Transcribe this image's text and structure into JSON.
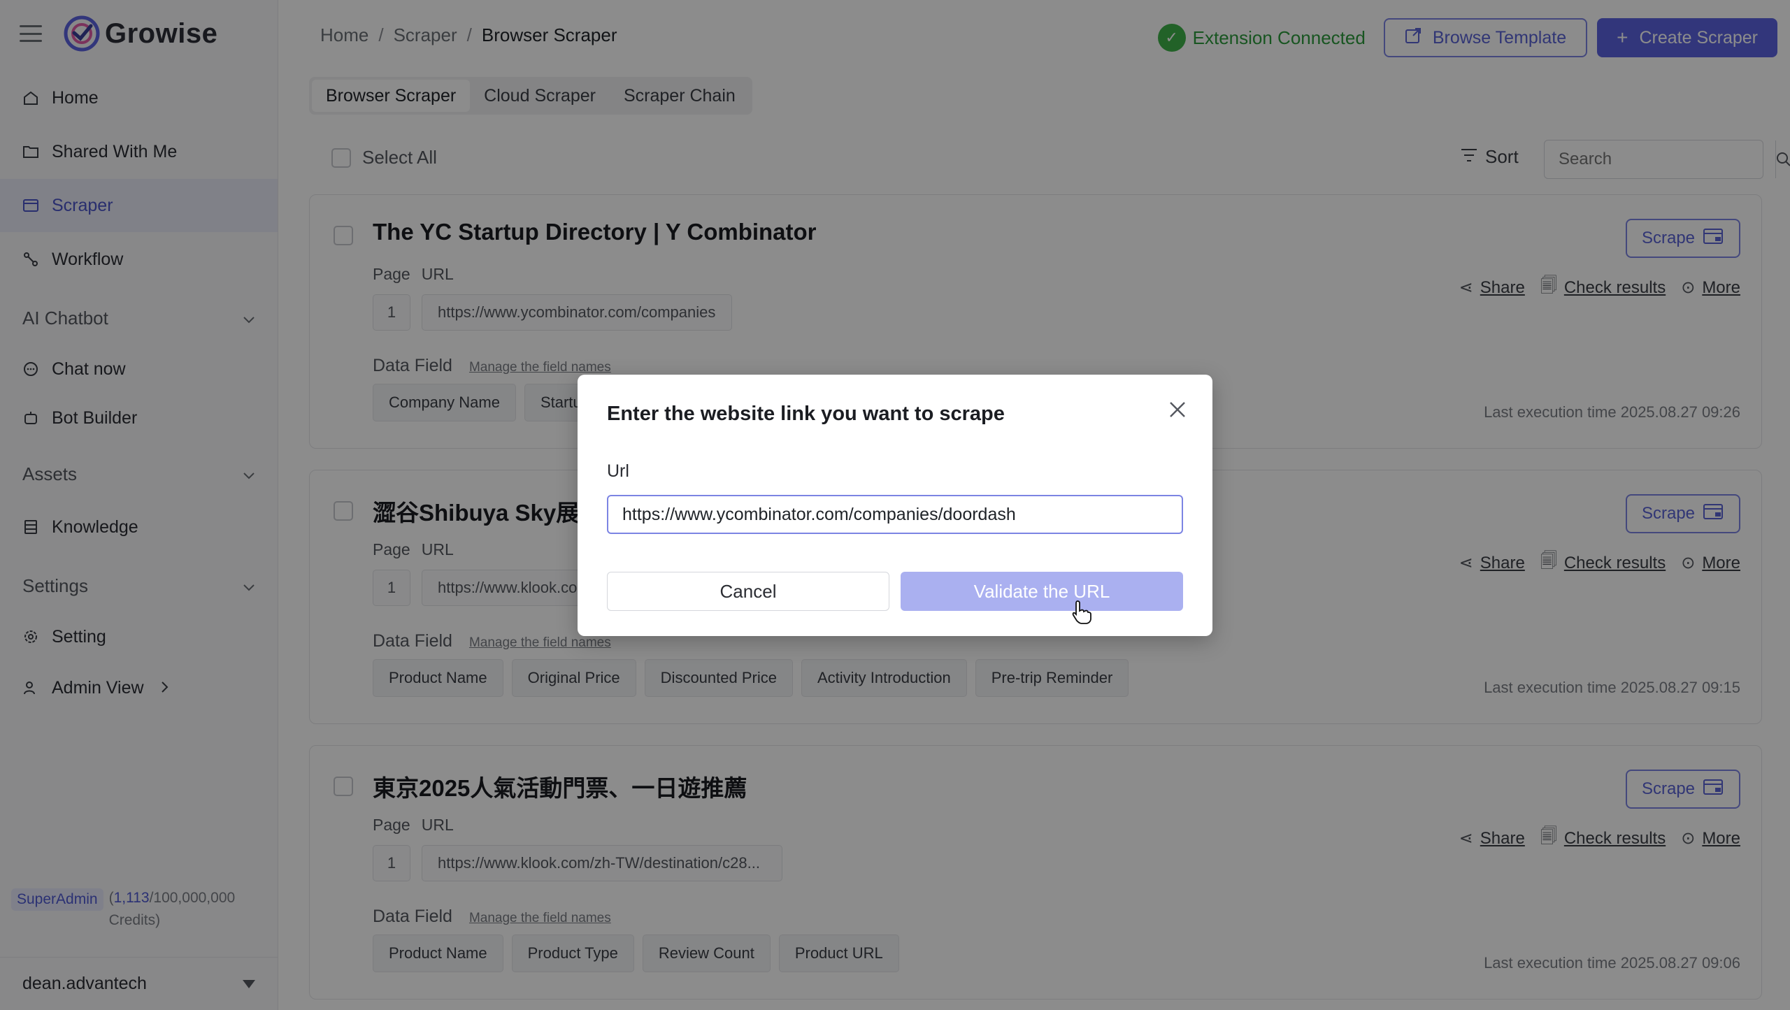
{
  "app": {
    "name": "Growise"
  },
  "sidebar": {
    "items": [
      {
        "label": "Home",
        "icon": "home-icon"
      },
      {
        "label": "Shared With Me",
        "icon": "folder-shared-icon"
      },
      {
        "label": "Scraper",
        "icon": "scraper-icon",
        "active": true
      },
      {
        "label": "Workflow",
        "icon": "workflow-icon"
      }
    ],
    "groups": {
      "ai_chatbot": "AI Chatbot",
      "chat_now": "Chat now",
      "bot_builder": "Bot Builder",
      "assets": "Assets",
      "knowledge": "Knowledge",
      "settings": "Settings",
      "setting": "Setting",
      "admin_view": "Admin View"
    },
    "badge": "SuperAdmin",
    "credits_used": "1,113",
    "credits_total": "/100,000,000",
    "credits_label": "Credits)",
    "credits_open": "(",
    "username": "dean.advantech"
  },
  "header": {
    "breadcrumb": [
      "Home",
      "Scraper",
      "Browser Scraper"
    ],
    "extension_status": "Extension Connected",
    "browse_template": "Browse Template",
    "create_scraper": "Create Scraper"
  },
  "tabs": [
    "Browser Scraper",
    "Cloud Scraper",
    "Scraper Chain"
  ],
  "toolbar": {
    "select_all": "Select All",
    "sort": "Sort",
    "search_placeholder": "Search"
  },
  "labels": {
    "page": "Page",
    "url": "URL",
    "data_field": "Data Field",
    "manage": "Manage the field names",
    "scrape": "Scrape",
    "share": "Share",
    "check_results": "Check results",
    "more": "More"
  },
  "cards": [
    {
      "title": "The YC Startup Directory | Y Combinator",
      "page": "1",
      "url": "https://www.ycombinator.com/companies",
      "tags": [
        "Company Name",
        "Startu"
      ],
      "last_exec": "Last execution time 2025.08.27 09:26"
    },
    {
      "title": "澀谷Shibuya Sky展望",
      "page": "1",
      "url": "https://www.klook.co",
      "tags": [
        "Product Name",
        "Original Price",
        "Discounted Price",
        "Activity Introduction",
        "Pre-trip Reminder"
      ],
      "last_exec": "Last execution time 2025.08.27 09:15"
    },
    {
      "title": "東京2025人氣活動門票、一日遊推薦",
      "page": "1",
      "url": "https://www.klook.com/zh-TW/destination/c28...",
      "tags": [
        "Product Name",
        "Product Type",
        "Review Count",
        "Product URL"
      ],
      "last_exec": "Last execution time 2025.08.27 09:06"
    }
  ],
  "modal": {
    "title": "Enter the website link you want to scrape",
    "label": "Url",
    "value": "https://www.ycombinator.com/companies/doordash",
    "cancel": "Cancel",
    "validate": "Validate the URL"
  },
  "colors": {
    "accent": "#5b63e0",
    "connected": "#3fb24a",
    "validate_disabled": "#aab0f0"
  }
}
